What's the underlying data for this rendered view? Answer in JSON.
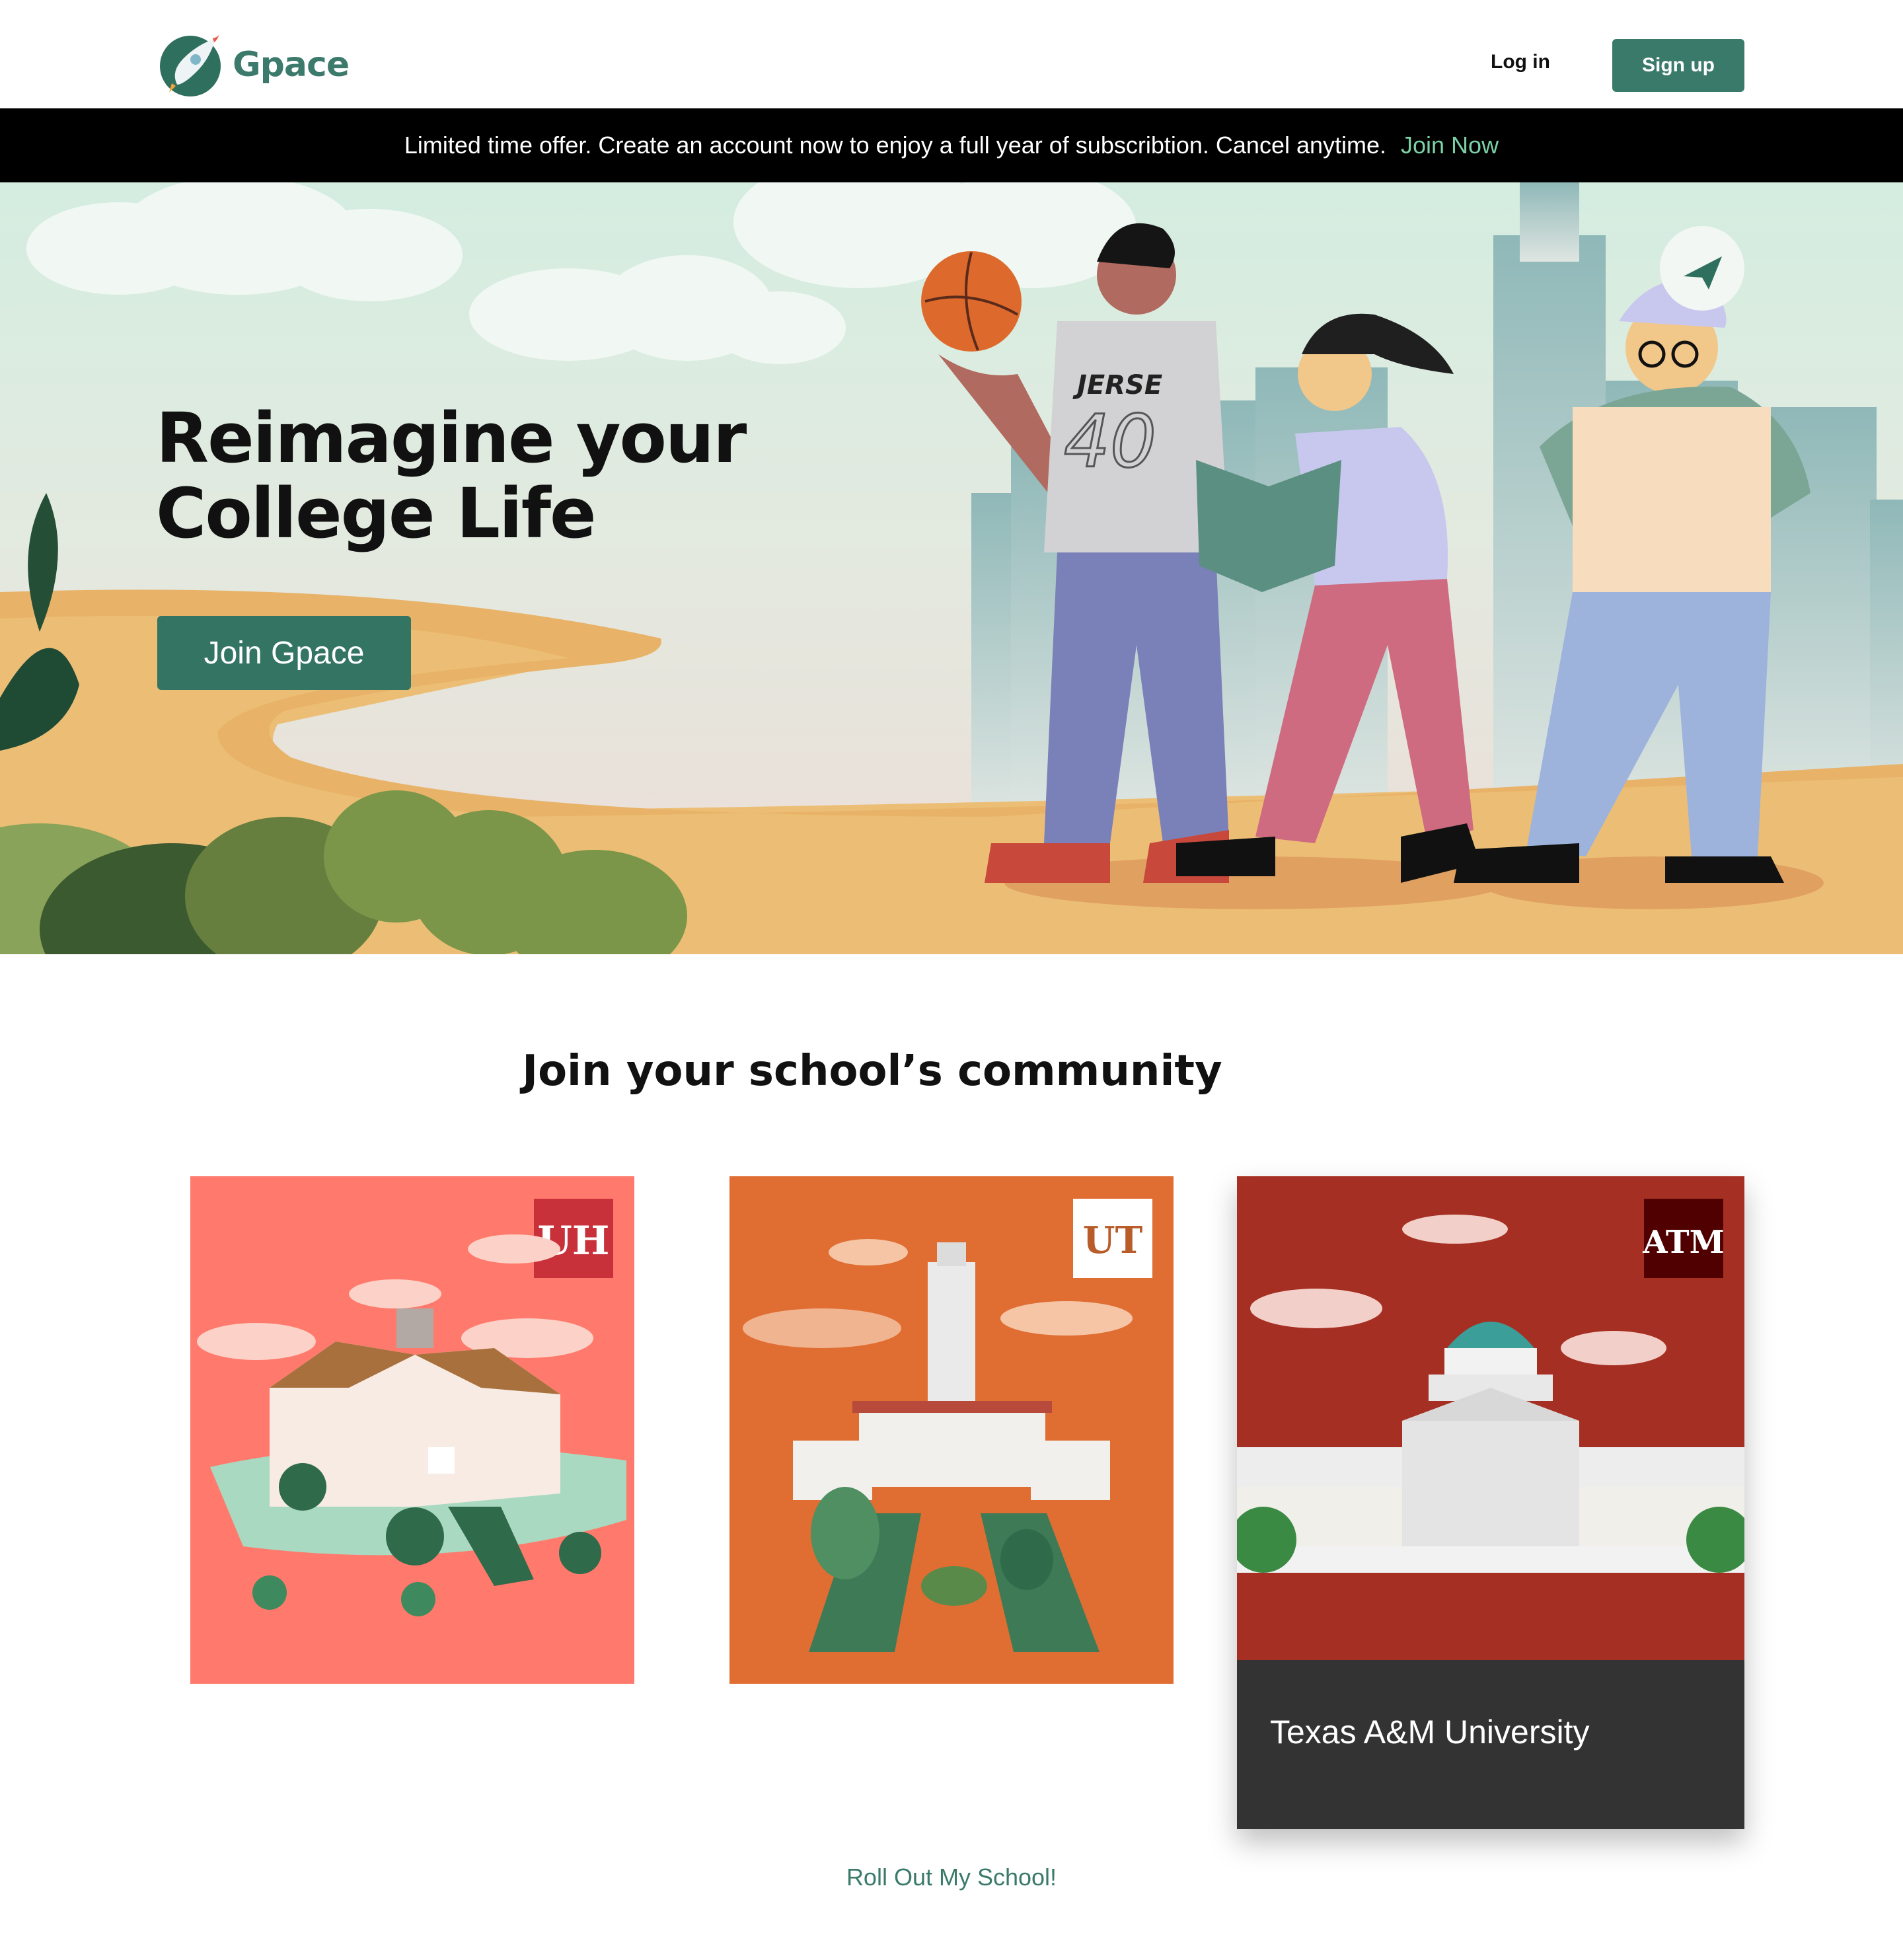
{
  "header": {
    "brand": "Gpace",
    "login_label": "Log in",
    "signup_label": "Sign up"
  },
  "banner": {
    "text": "Limited time offer. Create an account now to enjoy a full year of subscribtion. Cancel anytime.",
    "link_label": "Join Now"
  },
  "hero": {
    "title_line1": "Reimagine your",
    "title_line2": "College Life",
    "cta_label": "Join Gpace",
    "jersey_text": "JERSE",
    "jersey_number": "40"
  },
  "community": {
    "title": "Join your school’s community",
    "schools": [
      {
        "logo_text": "UH",
        "color": "#ff7a6c"
      },
      {
        "logo_text": "UT",
        "color": "#e06e33"
      },
      {
        "logo_text": "ATM",
        "name": "Texas A&M University",
        "color": "#a52f22"
      }
    ]
  },
  "footer": {
    "rollout_label": "Roll Out My School!"
  },
  "colors": {
    "brand": "#3a7a6a",
    "banner_bg": "#000000",
    "banner_link": "#7cd1a6"
  }
}
